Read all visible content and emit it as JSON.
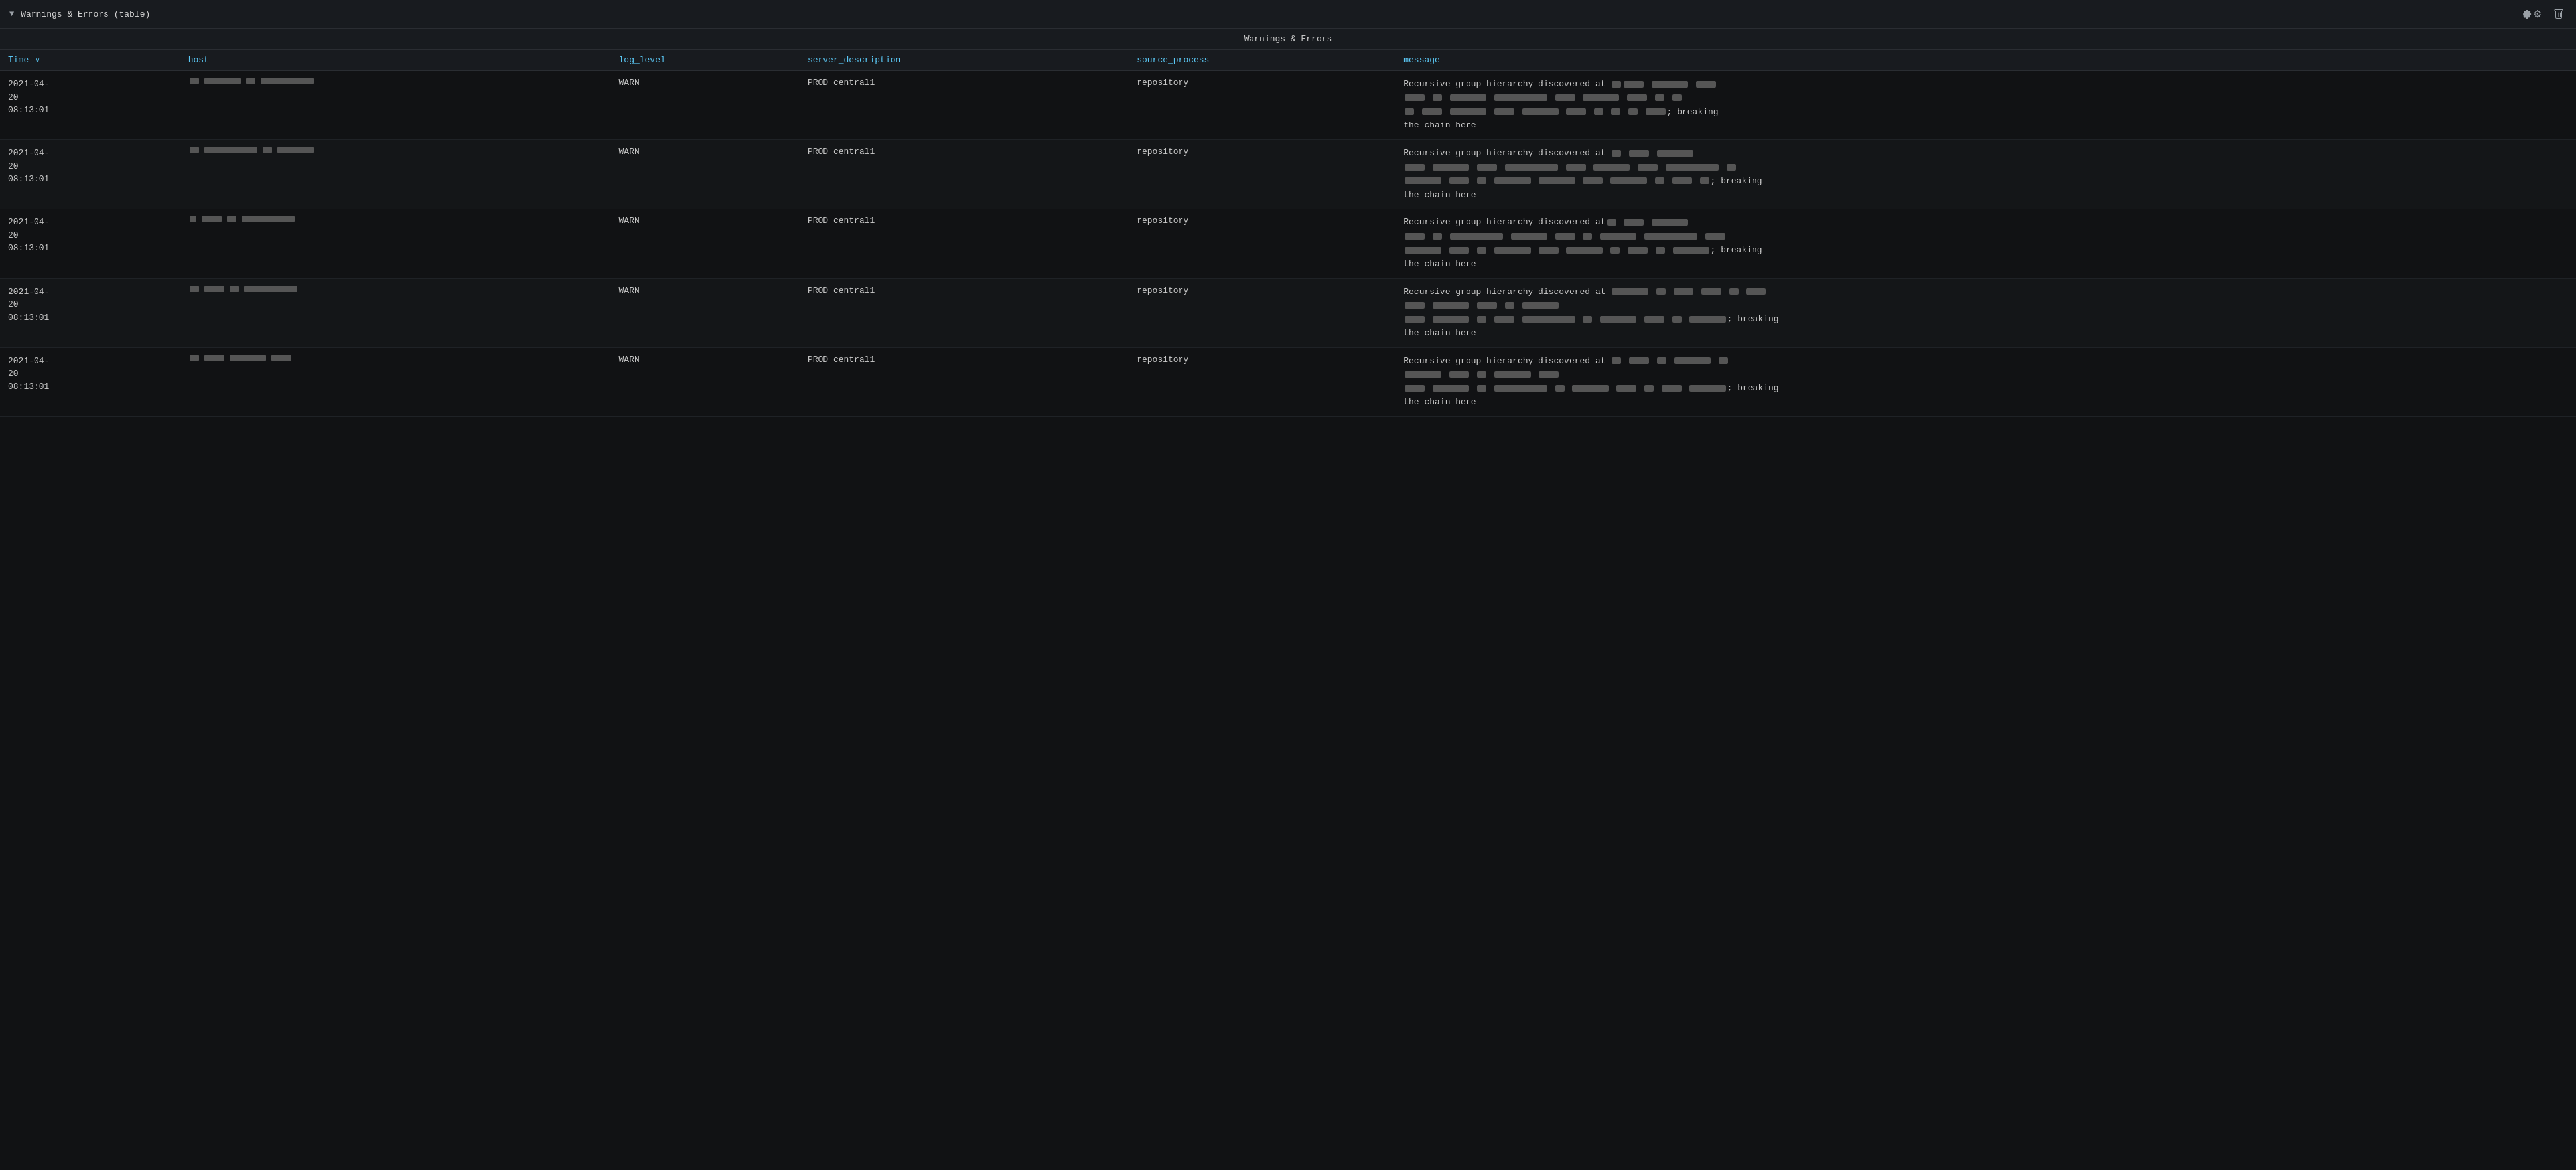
{
  "panel": {
    "title": "Warnings & Errors (table)",
    "table_title": "Warnings & Errors",
    "chevron": "▼",
    "gear_icon": "⚙",
    "trash_icon": "🗑"
  },
  "columns": [
    {
      "key": "time",
      "label": "Time",
      "sortable": true,
      "color": "blue"
    },
    {
      "key": "host",
      "label": "host",
      "sortable": false,
      "color": "blue"
    },
    {
      "key": "log_level",
      "label": "log_level",
      "sortable": false,
      "color": "blue"
    },
    {
      "key": "server_description",
      "label": "server_description",
      "sortable": false,
      "color": "blue"
    },
    {
      "key": "source_process",
      "label": "source_process",
      "sortable": false,
      "color": "blue"
    },
    {
      "key": "message",
      "label": "message",
      "sortable": false,
      "color": "blue"
    }
  ],
  "rows": [
    {
      "time": "2021-04-\n20\n08:13:01",
      "log_level": "WARN",
      "server_description": "PROD central1",
      "source_process": "repository",
      "message_prefix": "Recursive group hierarchy discovered at",
      "message_suffix": "; breaking\nthe chain here"
    },
    {
      "time": "2021-04-\n20\n08:13:01",
      "log_level": "WARN",
      "server_description": "PROD central1",
      "source_process": "repository",
      "message_prefix": "Recursive group hierarchy discovered at",
      "message_suffix": "; breaking\nthe chain here"
    },
    {
      "time": "2021-04-\n20\n08:13:01",
      "log_level": "WARN",
      "server_description": "PROD central1",
      "source_process": "repository",
      "message_prefix": "Recursive group hierarchy discovered at",
      "message_suffix": "; breaking\nthe chain here"
    },
    {
      "time": "2021-04-\n20\n08:13:01",
      "log_level": "WARN",
      "server_description": "PROD central1",
      "source_process": "repository",
      "message_prefix": "Recursive group hierarchy discovered at",
      "message_suffix": "; breaking\nthe chain here"
    },
    {
      "time": "2021-04-\n20\n08:13:01",
      "log_level": "WARN",
      "server_description": "PROD central1",
      "source_process": "repository",
      "message_prefix": "Recursive group hierarchy discovered at",
      "message_suffix": "; breaking\nthe chain here"
    }
  ],
  "colors": {
    "blue_header": "#5bc8f5",
    "bg_dark": "#111214",
    "bg_panel": "#181b1f",
    "border": "#2a2d32",
    "text_main": "#c8c8c8",
    "redacted": "#555"
  }
}
